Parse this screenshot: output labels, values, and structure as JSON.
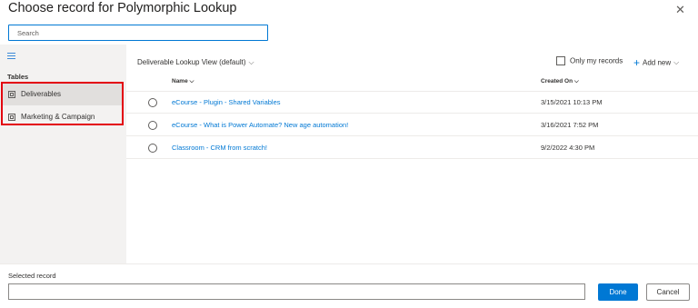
{
  "dialog": {
    "title": "Choose record for Polymorphic Lookup",
    "close_icon": "close-icon"
  },
  "search": {
    "placeholder": "Search",
    "value": ""
  },
  "sidebar": {
    "menu_icon": "hamburger-icon",
    "heading": "Tables",
    "items": [
      {
        "label": "Deliverables",
        "icon": "table-icon",
        "selected": true
      },
      {
        "label": "Marketing & Campaign",
        "icon": "table-icon",
        "selected": false
      }
    ]
  },
  "view": {
    "title": "Deliverable Lookup View (default)",
    "only_my_records_label": "Only my records",
    "add_new_label": "Add new"
  },
  "table": {
    "columns": [
      "Name",
      "Created On"
    ],
    "rows": [
      {
        "name": "eCourse - Plugin - Shared Variables",
        "created_on": "3/15/2021 10:13 PM"
      },
      {
        "name": "eCourse - What is Power Automate? New age automation!",
        "created_on": "3/16/2021 7:52 PM"
      },
      {
        "name": "Classroom - CRM from scratch!",
        "created_on": "9/2/2022 4:30 PM"
      }
    ]
  },
  "footer": {
    "selected_record_label": "Selected record",
    "selected_record_value": "",
    "done_label": "Done",
    "cancel_label": "Cancel"
  },
  "colors": {
    "accent": "#0078d4",
    "highlight_border": "#e3000f",
    "sidebar_bg": "#f3f2f1",
    "selected_item_bg": "#e1dfdd"
  }
}
